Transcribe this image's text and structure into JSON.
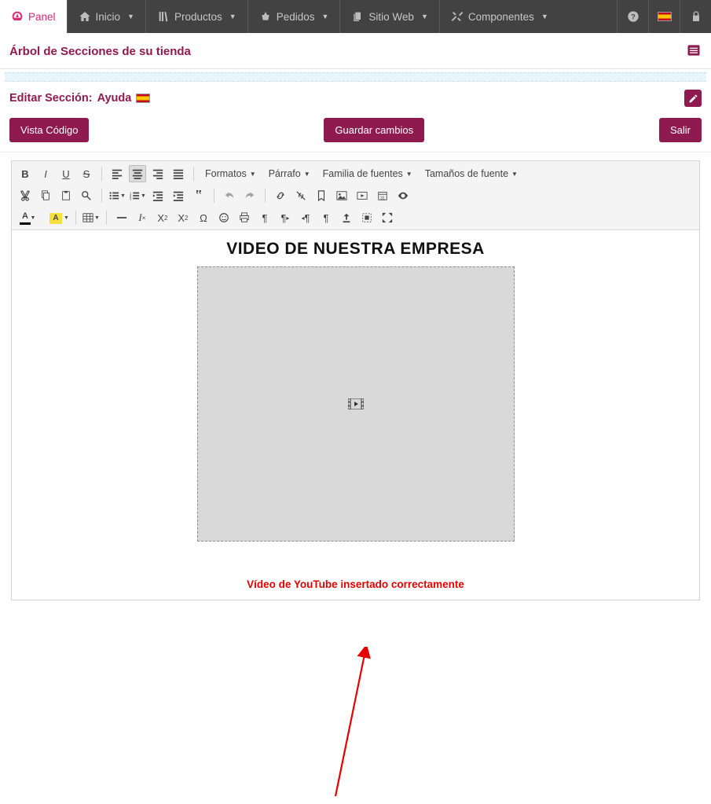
{
  "nav": {
    "panel": "Panel",
    "inicio": "Inicio",
    "productos": "Productos",
    "pedidos": "Pedidos",
    "sitioweb": "Sitio Web",
    "componentes": "Componentes"
  },
  "section": {
    "tree_title": "Árbol de Secciones de su tienda",
    "edit_prefix": "Editar Sección:",
    "edit_name": "Ayuda"
  },
  "actions": {
    "view_code": "Vista Código",
    "save": "Guardar cambios",
    "exit": "Salir"
  },
  "toolbar": {
    "formats": "Formatos",
    "paragraph": "Párrafo",
    "font_family": "Familia de fuentes",
    "font_sizes": "Tamaños de fuente"
  },
  "content": {
    "heading": "VIDEO DE NUESTRA EMPRESA"
  },
  "annotation": {
    "text": "Vídeo de YouTube insertado correctamente"
  }
}
